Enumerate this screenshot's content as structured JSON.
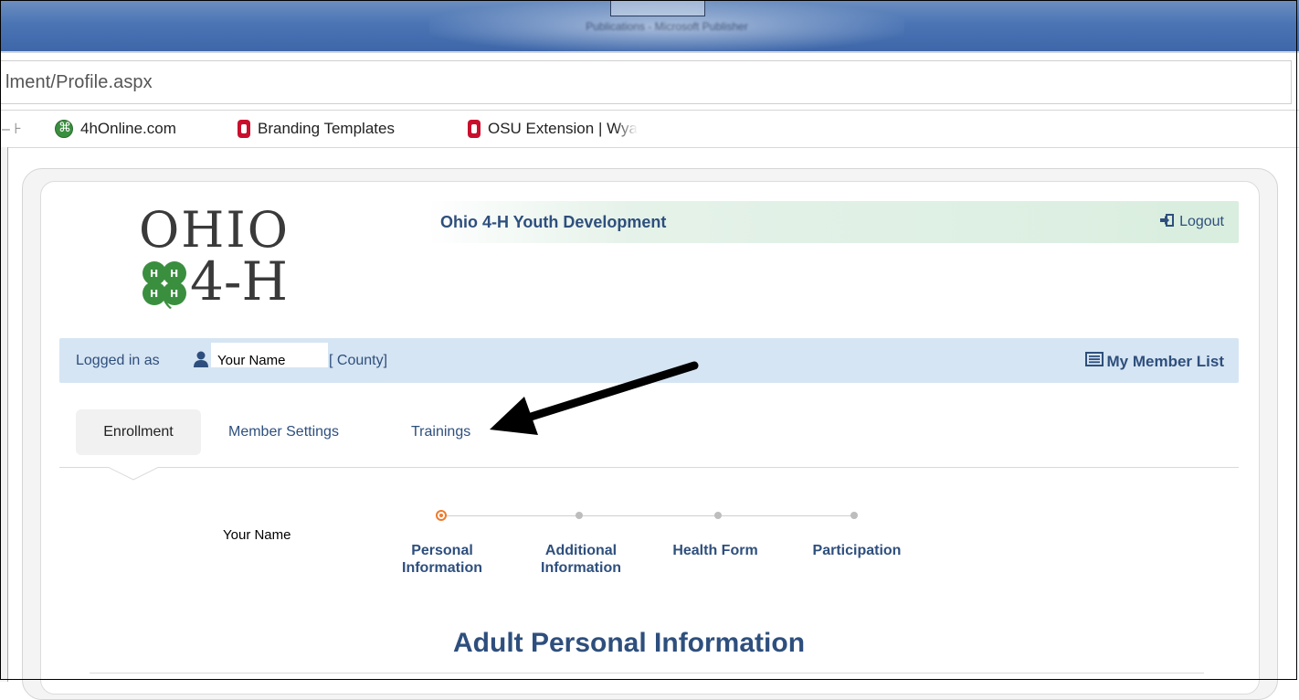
{
  "browser": {
    "title_text": "Publications - Microsoft Publisher",
    "url": "lment/Profile.aspx",
    "favorites": [
      {
        "label": "4hOnline.com",
        "icon": "4h-clover-favicon"
      },
      {
        "label": "Branding Templates",
        "icon": "osu-block-o-favicon"
      },
      {
        "label": "OSU Extension | Wya",
        "icon": "osu-block-o-favicon"
      }
    ]
  },
  "header": {
    "logo_line1": "OHIO",
    "logo_line2": "4-H",
    "org_name": "Ohio 4-H Youth Development",
    "logout_label": "Logout"
  },
  "login_bar": {
    "logged_in_label": "Logged in as",
    "user_name": "Your Name",
    "county": "[ County]",
    "member_list_label": "My Member List"
  },
  "tabs": [
    {
      "label": "Enrollment",
      "active": true
    },
    {
      "label": "Member Settings",
      "active": false
    },
    {
      "label": "Trainings",
      "active": false
    }
  ],
  "member": {
    "name": "Your Name"
  },
  "steps": [
    {
      "line1": "Personal",
      "line2": "Information",
      "active": true
    },
    {
      "line1": "Additional",
      "line2": "Information",
      "active": false
    },
    {
      "line1": "Health Form",
      "line2": "",
      "active": false
    },
    {
      "line1": "Participation",
      "line2": "",
      "active": false
    }
  ],
  "main": {
    "heading": "Adult Personal Information"
  },
  "colors": {
    "brand_text": "#2e4f7d",
    "login_bar_bg": "#d6e5f3",
    "step_active": "#f07a2c",
    "clover_green": "#3a8f3f"
  }
}
